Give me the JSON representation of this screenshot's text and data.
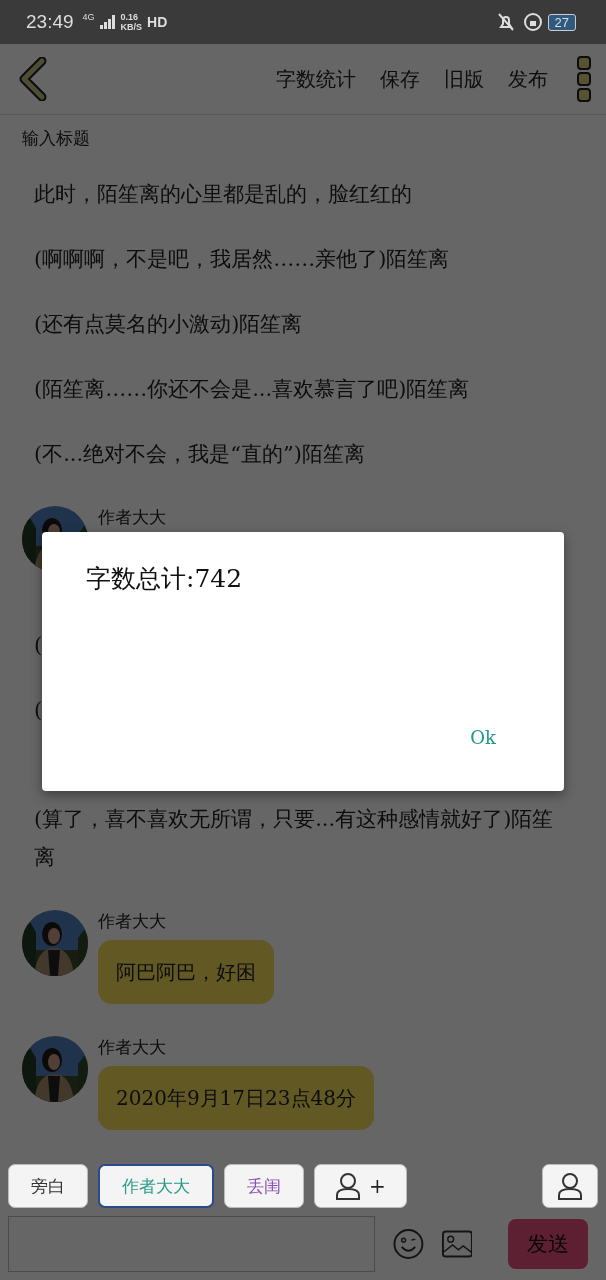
{
  "status_bar": {
    "time": "23:49",
    "network": "4G",
    "speed": "0.16",
    "speed_unit": "KB/S",
    "hd": "HD",
    "battery": "27"
  },
  "toolbar": {
    "actions": [
      "字数统计",
      "保存",
      "旧版",
      "发布"
    ]
  },
  "title_field": {
    "placeholder": "输入标题"
  },
  "content": [
    {
      "kind": "line",
      "text": "此时，陌笙离的心里都是乱的，脸红红的"
    },
    {
      "kind": "line",
      "text": "(啊啊啊，不是吧，我居然……亲他了)陌笙离"
    },
    {
      "kind": "line",
      "text": "(还有点莫名的小激动)陌笙离"
    },
    {
      "kind": "line",
      "text": "(陌笙离……你还不会是...喜欢慕言了吧)陌笙离"
    },
    {
      "kind": "line",
      "text": "(不...绝对不会，我是“直的”)陌笙离"
    },
    {
      "kind": "message",
      "speaker": "作者大大"
    },
    {
      "kind": "line",
      "text": "("
    },
    {
      "kind": "line",
      "text": "("
    },
    {
      "kind": "line",
      "text": "(算了，喜不喜欢无所谓，只要...有这种感情就好了)陌笙离"
    },
    {
      "kind": "message",
      "speaker": "作者大大",
      "text": "阿巴阿巴，好困"
    },
    {
      "kind": "message",
      "speaker": "作者大大",
      "text": "2020年9月17日23点48分"
    }
  ],
  "roles": [
    {
      "label": "旁白",
      "selected": false,
      "color": "#333333"
    },
    {
      "label": "作者大大",
      "selected": true,
      "color": "#2a9a8a"
    },
    {
      "label": "丢闺",
      "selected": false,
      "color": "#8a4fb0"
    }
  ],
  "add_role": {
    "label": "+"
  },
  "send_button": {
    "label": "发送"
  },
  "dialog": {
    "message": "字数总计:742",
    "button": "Ok"
  }
}
